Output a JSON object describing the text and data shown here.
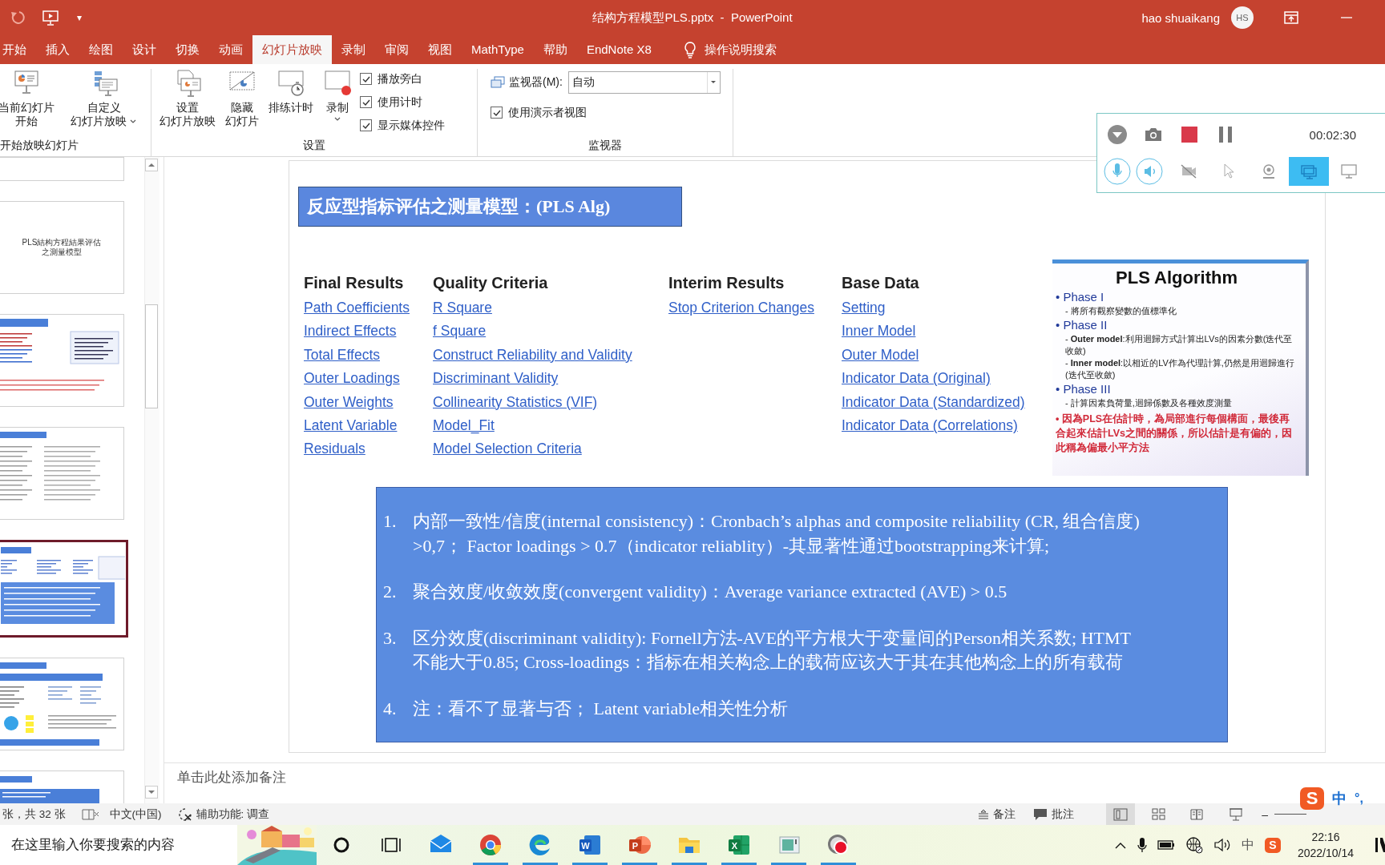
{
  "title_bar": {
    "quick_access_more": "▾",
    "title": "结构方程模型PLS.pptx  -  PowerPoint",
    "user": "hao shuaikang",
    "avatar": "HS"
  },
  "ribbon_tabs": [
    {
      "label": "开始",
      "selected": false
    },
    {
      "label": "插入",
      "selected": false
    },
    {
      "label": "绘图",
      "selected": false
    },
    {
      "label": "设计",
      "selected": false
    },
    {
      "label": "切换",
      "selected": false
    },
    {
      "label": "动画",
      "selected": false
    },
    {
      "label": "幻灯片放映",
      "selected": true
    },
    {
      "label": "录制",
      "selected": false
    },
    {
      "label": "审阅",
      "selected": false
    },
    {
      "label": "视图",
      "selected": false
    },
    {
      "label": "MathType",
      "selected": false
    },
    {
      "label": "帮助",
      "selected": false
    },
    {
      "label": "EndNote X8",
      "selected": false
    }
  ],
  "tell_me": "操作说明搜索",
  "ribbon_groups": [
    {
      "label": "开始放映幻灯片",
      "buttons": [
        {
          "lines": [
            "当前幻灯片",
            "开始"
          ],
          "has_menu": false
        },
        {
          "lines": [
            "自定义",
            "幻灯片放映"
          ],
          "has_menu": true
        }
      ]
    },
    {
      "label": "设置",
      "buttons": [
        {
          "lines": [
            "设置",
            "幻灯片放映"
          ],
          "has_menu": false
        },
        {
          "lines": [
            "隐藏",
            "幻灯片"
          ],
          "has_menu": false
        },
        {
          "lines": [
            "排练计时"
          ],
          "has_menu": false
        },
        {
          "lines": [
            "录制"
          ],
          "has_menu": true
        }
      ],
      "checkboxes": [
        {
          "label": "播放旁白",
          "checked": true
        },
        {
          "label": "使用计时",
          "checked": true
        },
        {
          "label": "显示媒体控件",
          "checked": true
        }
      ]
    },
    {
      "label": "监视器",
      "monitor": {
        "label": "监视器(M):",
        "value": "自动"
      },
      "checkboxes": [
        {
          "label": "使用演示者视图",
          "checked": true
        }
      ]
    }
  ],
  "thumbnails": [
    {
      "kind": "diagram",
      "selected": false
    },
    {
      "kind": "title",
      "text": [
        "PLS結构方程結果评估",
        "之測量模型"
      ],
      "selected": false
    },
    {
      "kind": "text-image",
      "selected": false
    },
    {
      "kind": "table",
      "selected": false
    },
    {
      "kind": "links",
      "selected": true
    },
    {
      "kind": "chart",
      "selected": false
    },
    {
      "kind": "box",
      "selected": false
    }
  ],
  "slide": {
    "title": "反应型指标评估之测量模型：(PLS Alg)",
    "link_columns": [
      {
        "heading": "Final Results",
        "links": [
          "Path Coefficients",
          "Indirect Effects",
          "Total Effects",
          "Outer Loadings",
          "Outer Weights",
          "Latent Variable",
          "Residuals"
        ]
      },
      {
        "heading": "Quality Criteria",
        "links": [
          "R Square",
          "f Square",
          "Construct Reliability and Validity",
          "Discriminant Validity",
          "Collinearity Statistics (VIF)",
          "Model_Fit",
          "Model Selection Criteria"
        ]
      },
      {
        "heading": "Interim Results",
        "links": [
          "Stop Criterion Changes"
        ]
      },
      {
        "heading": "Base Data",
        "links": [
          "Setting",
          "Inner Model",
          "Outer Model",
          "Indicator Data (Original)",
          "Indicator Data (Standardized)",
          "Indicator Data (Correlations)"
        ]
      }
    ],
    "algorithm_image": {
      "title": "PLS Algorithm",
      "phases": [
        {
          "label": "•  Phase I",
          "notes": [
            "-  將所有觀察變數的值標準化"
          ]
        },
        {
          "label": "•  Phase II",
          "notes": [
            "-  **Outer model**:利用迴歸方式計算出LVs的因素分數(迭代至收斂)",
            "-  **Inner model**:以相近的LV作為代理計算,仍然是用迴歸進行(迭代至收斂)"
          ]
        },
        {
          "label": "•  Phase III",
          "notes": [
            "-  計算因素負荷量,迴歸係數及各種效度測量"
          ]
        }
      ],
      "conclusion": "•  因為PLS在估計時，為局部進行每個構面，最後再合起來估計LVs之間的關係，所以估計是有偏的，因此稱為偏最小平方法"
    },
    "box_items": [
      {
        "number": "1.",
        "lines": [
          "内部一致性/信度(internal consistency)：Cronbach’s alphas and composite reliability (CR, 组合信度)",
          ">0,7； Factor loadings > 0.7（indicator reliablity）-其显著性通过bootstrapping来计算;"
        ]
      },
      {
        "number": "2.",
        "lines": [
          "聚合效度/收敛效度(convergent validity)：Average variance extracted (AVE) > 0.5"
        ]
      },
      {
        "number": "3.",
        "lines": [
          "区分效度(discriminant validity): Fornell方法-AVE的平方根大于变量间的Person相关系数; HTMT",
          "不能大于0.85; Cross-loadings：指标在相关构念上的载荷应该大于其在其他构念上的所有载荷"
        ]
      },
      {
        "number": "4.",
        "lines": [
          "注：看不了显著与否； Latent variable相关性分析"
        ]
      }
    ]
  },
  "notes_placeholder": "单击此处添加备注",
  "recorder": {
    "time": "00:02:30",
    "toggles": [
      {
        "on": true
      },
      {
        "on": true
      }
    ],
    "capture_modes": [
      {
        "selected": false
      },
      {
        "selected": false
      },
      {
        "selected": false
      },
      {
        "selected": true
      },
      {
        "selected": false
      }
    ]
  },
  "status_bar": {
    "slide_count": "张，共 32 张",
    "language": "中文(中国)",
    "accessibility": "辅助功能: 调查",
    "notes": "备注",
    "comments": "批注",
    "views": [
      {
        "selected": true
      },
      {
        "selected": false
      },
      {
        "selected": false
      },
      {
        "selected": false
      }
    ],
    "zoom_out": "–"
  },
  "ime_bar": {
    "logo": "S",
    "mode": "中",
    "punct": "°,"
  },
  "taskbar": {
    "search": {
      "placeholder": "在这里输入你要搜索的内容"
    },
    "apps": [
      {
        "running": false
      },
      {
        "running": true
      },
      {
        "running": true
      },
      {
        "letter": "W",
        "running": true
      },
      {
        "letter": "P",
        "running": true
      },
      {
        "running": true
      },
      {
        "letter": "X",
        "running": true
      },
      {
        "running": true
      },
      {
        "running": true
      }
    ],
    "tray": {
      "ime": "中",
      "sogou": "S",
      "time": "22:16",
      "date": "2022/10/14"
    }
  }
}
